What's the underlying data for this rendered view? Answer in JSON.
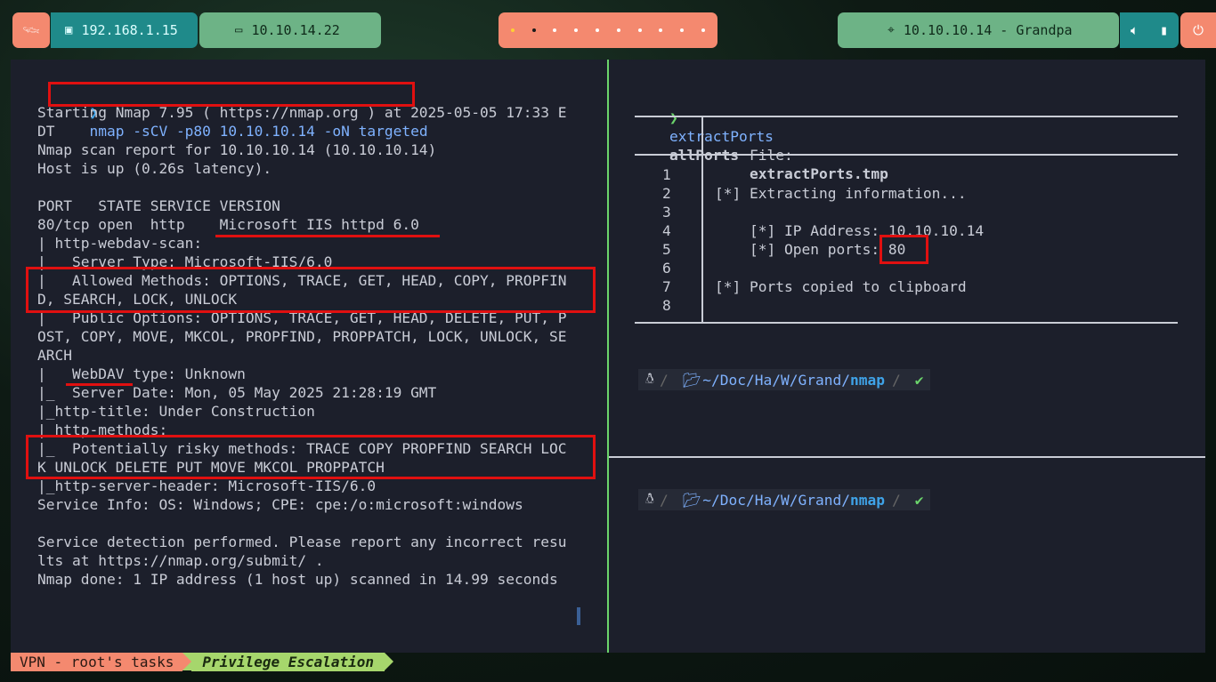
{
  "topbar": {
    "local_ip": "192.168.1.15",
    "vpn_ip": "10.10.14.22",
    "target": "10.10.10.14 - Grandpa"
  },
  "left_pane": {
    "prompt_symbol": "❯",
    "command": "nmap -sCV -p80 10.10.10.14 -oN targeted",
    "output_lines": [
      "Starting Nmap 7.95 ( https://nmap.org ) at 2025-05-05 17:33 E",
      "DT",
      "Nmap scan report for 10.10.10.14 (10.10.10.14)",
      "Host is up (0.26s latency).",
      "",
      "PORT   STATE SERVICE VERSION",
      "80/tcp open  http    Microsoft IIS httpd 6.0",
      "| http-webdav-scan:",
      "|   Server Type: Microsoft-IIS/6.0",
      "|   Allowed Methods: OPTIONS, TRACE, GET, HEAD, COPY, PROPFIN",
      "D, SEARCH, LOCK, UNLOCK",
      "|   Public Options: OPTIONS, TRACE, GET, HEAD, DELETE, PUT, P",
      "OST, COPY, MOVE, MKCOL, PROPFIND, PROPPATCH, LOCK, UNLOCK, SE",
      "ARCH",
      "|   WebDAV type: Unknown",
      "|_  Server Date: Mon, 05 May 2025 21:28:19 GMT",
      "|_http-title: Under Construction",
      "| http-methods:",
      "|_  Potentially risky methods: TRACE COPY PROPFIND SEARCH LOC",
      "K UNLOCK DELETE PUT MOVE MKCOL PROPPATCH",
      "|_http-server-header: Microsoft-IIS/6.0",
      "Service Info: OS: Windows; CPE: cpe:/o:microsoft:windows",
      "",
      "Service detection performed. Please report any incorrect resu",
      "lts at https://nmap.org/submit/ .",
      "Nmap done: 1 IP address (1 host up) scanned in 14.99 seconds"
    ]
  },
  "right_pane": {
    "command_name": "extractPorts",
    "command_arg": "allPorts",
    "file_label": "File:",
    "file_name": "extractPorts.tmp",
    "line_numbers": [
      "1",
      "2",
      "3",
      "4",
      "5",
      "6",
      "7",
      "8"
    ],
    "content_lines": [
      "",
      "[*] Extracting information...",
      "",
      "    [*] IP Address: 10.10.10.14",
      "    [*] Open ports: 80",
      "",
      "[*] Ports copied to clipboard",
      ""
    ],
    "prompt_path_prefix": "~/Doc/Ha/W/Grand/",
    "prompt_path_last": "nmap"
  },
  "statusbar": {
    "session": "VPN - root's tasks",
    "window": "Privilege Escalation"
  }
}
